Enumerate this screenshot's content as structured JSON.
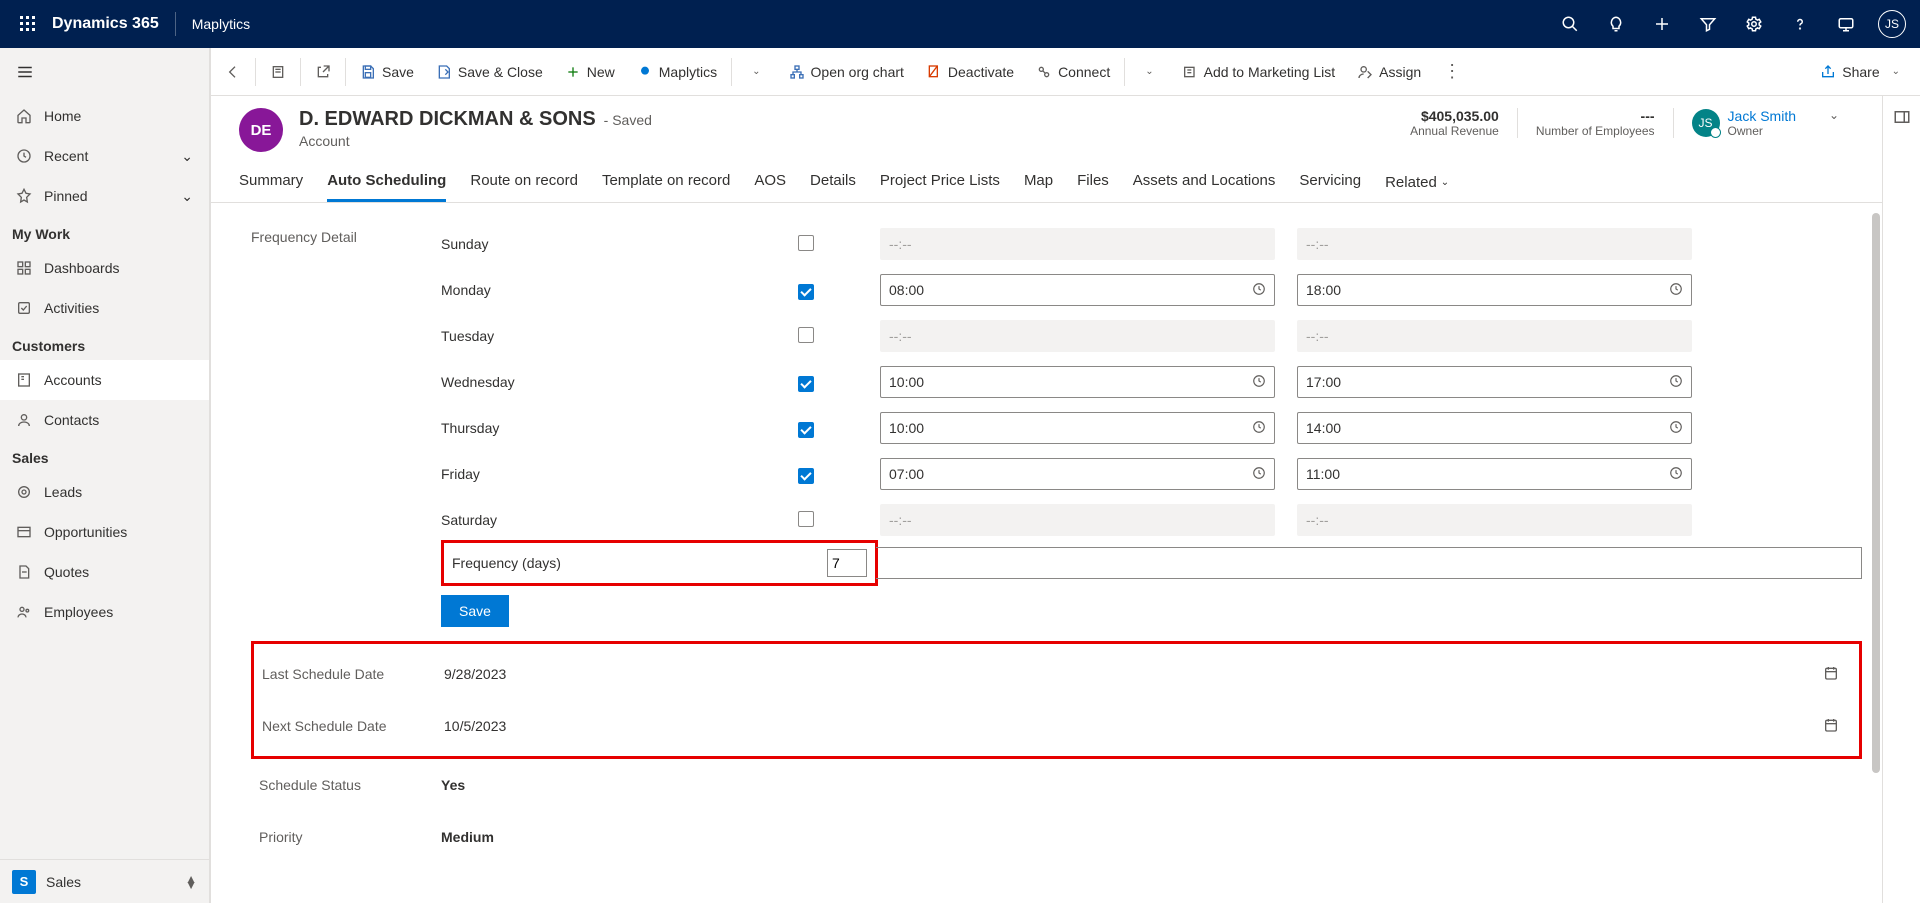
{
  "header": {
    "brand": "Dynamics 365",
    "app": "Maplytics",
    "avatar_initials": "JS"
  },
  "leftnav": {
    "home": "Home",
    "recent": "Recent",
    "pinned": "Pinned",
    "group_mywork": "My Work",
    "dashboards": "Dashboards",
    "activities": "Activities",
    "group_customers": "Customers",
    "accounts": "Accounts",
    "contacts": "Contacts",
    "group_sales": "Sales",
    "leads": "Leads",
    "opportunities": "Opportunities",
    "quotes": "Quotes",
    "employees": "Employees",
    "area_switch_label": "Sales",
    "area_switch_letter": "S"
  },
  "cmdbar": {
    "save": "Save",
    "save_close": "Save & Close",
    "new": "New",
    "maplytics": "Maplytics",
    "open_org_chart": "Open org chart",
    "deactivate": "Deactivate",
    "connect": "Connect",
    "add_marketing": "Add to Marketing List",
    "assign": "Assign",
    "share": "Share"
  },
  "record": {
    "avatar_initials": "DE",
    "title": "D. EDWARD DICKMAN & SONS",
    "saved_tag": "- Saved",
    "subtitle": "Account",
    "revenue_value": "$405,035.00",
    "revenue_label": "Annual Revenue",
    "employees_value": "---",
    "employees_label": "Number of Employees",
    "owner_name": "Jack Smith",
    "owner_label": "Owner",
    "owner_initials": "JS"
  },
  "tabs": {
    "summary": "Summary",
    "auto_scheduling": "Auto Scheduling",
    "route_on_record": "Route on record",
    "template_on_record": "Template on record",
    "aos": "AOS",
    "details": "Details",
    "project_price_lists": "Project Price Lists",
    "map": "Map",
    "files": "Files",
    "assets_locations": "Assets and Locations",
    "servicing": "Servicing",
    "related": "Related"
  },
  "form": {
    "frequency_detail_label": "Frequency Detail",
    "days": {
      "sunday": {
        "label": "Sunday",
        "checked": false,
        "start": "",
        "end": ""
      },
      "monday": {
        "label": "Monday",
        "checked": true,
        "start": "08:00",
        "end": "18:00"
      },
      "tuesday": {
        "label": "Tuesday",
        "checked": false,
        "start": "",
        "end": ""
      },
      "wednesday": {
        "label": "Wednesday",
        "checked": true,
        "start": "10:00",
        "end": "17:00"
      },
      "thursday": {
        "label": "Thursday",
        "checked": true,
        "start": "10:00",
        "end": "14:00"
      },
      "friday": {
        "label": "Friday",
        "checked": true,
        "start": "07:00",
        "end": "11:00"
      },
      "saturday": {
        "label": "Saturday",
        "checked": false,
        "start": "",
        "end": ""
      }
    },
    "time_placeholder": "--:--",
    "frequency_label": "Frequency (days)",
    "frequency_value": "7",
    "save_btn": "Save",
    "last_schedule_label": "Last Schedule Date",
    "last_schedule_value": "9/28/2023",
    "next_schedule_label": "Next Schedule Date",
    "next_schedule_value": "10/5/2023",
    "schedule_status_label": "Schedule Status",
    "schedule_status_value": "Yes",
    "priority_label": "Priority",
    "priority_value": "Medium"
  }
}
